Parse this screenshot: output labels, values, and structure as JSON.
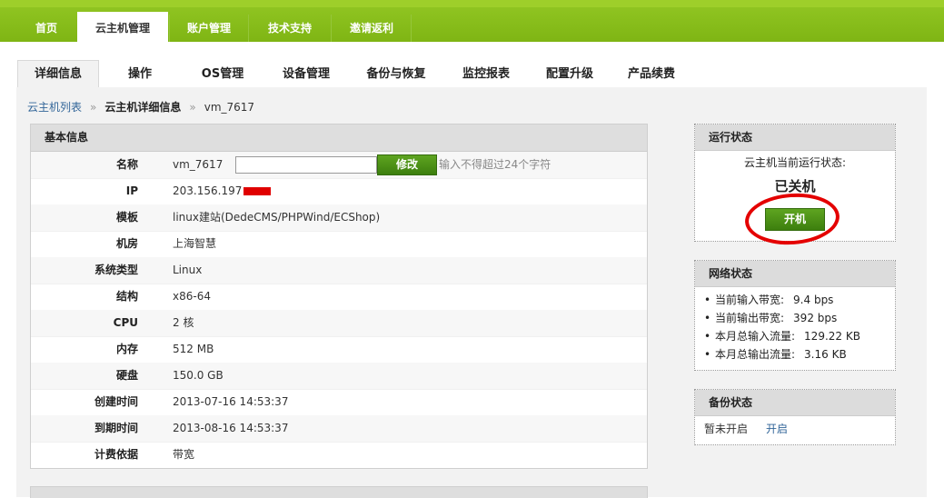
{
  "topnav": {
    "items": [
      "首页",
      "云主机管理",
      "账户管理",
      "技术支持",
      "邀请返利"
    ],
    "active": "云主机管理"
  },
  "tabs": [
    "详细信息",
    "操作",
    "OS管理",
    "设备管理",
    "备份与恢复",
    "监控报表",
    "配置升级",
    "产品续费"
  ],
  "breadcrumb": {
    "link": "云主机列表",
    "sep": "»",
    "current": "云主机详细信息",
    "vm": "vm_7617"
  },
  "basic_info": {
    "title": "基本信息",
    "name_label": "名称",
    "name_value": "vm_7617",
    "modify_label": "修改",
    "hint": "输入不得超过24个字符",
    "rows": [
      {
        "label": "IP",
        "value": "203.156.197"
      },
      {
        "label": "模板",
        "value": "linux建站(DedeCMS/PHPWind/ECShop)"
      },
      {
        "label": "机房",
        "value": "上海智慧"
      },
      {
        "label": "系统类型",
        "value": "Linux"
      },
      {
        "label": "结构",
        "value": "x86-64"
      },
      {
        "label": "CPU",
        "value": "2 核"
      },
      {
        "label": "内存",
        "value": "512 MB"
      },
      {
        "label": "硬盘",
        "value": "150.0 GB"
      },
      {
        "label": "创建时间",
        "value": "2013-07-16 14:53:37"
      },
      {
        "label": "到期时间",
        "value": "2013-08-16 14:53:37"
      },
      {
        "label": "计费依据",
        "value": "带宽"
      }
    ]
  },
  "run_status": {
    "title": "运行状态",
    "label": "云主机当前运行状态:",
    "state": "已关机",
    "boot_label": "开机"
  },
  "net_status": {
    "title": "网络状态",
    "items": [
      {
        "label": "当前输入带宽:",
        "value": "9.4 bps"
      },
      {
        "label": "当前输出带宽:",
        "value": "392 bps"
      },
      {
        "label": "本月总输入流量:",
        "value": "129.22 KB"
      },
      {
        "label": "本月总输出流量:",
        "value": "3.16 KB"
      }
    ]
  },
  "backup_status": {
    "title": "备份状态",
    "state": "暂未开启",
    "enable_label": "开启"
  },
  "colors": {
    "nav_green": "#7fb514",
    "button_green": "#4a8f14",
    "annotation_red": "#e40000",
    "link_blue": "#336699"
  }
}
